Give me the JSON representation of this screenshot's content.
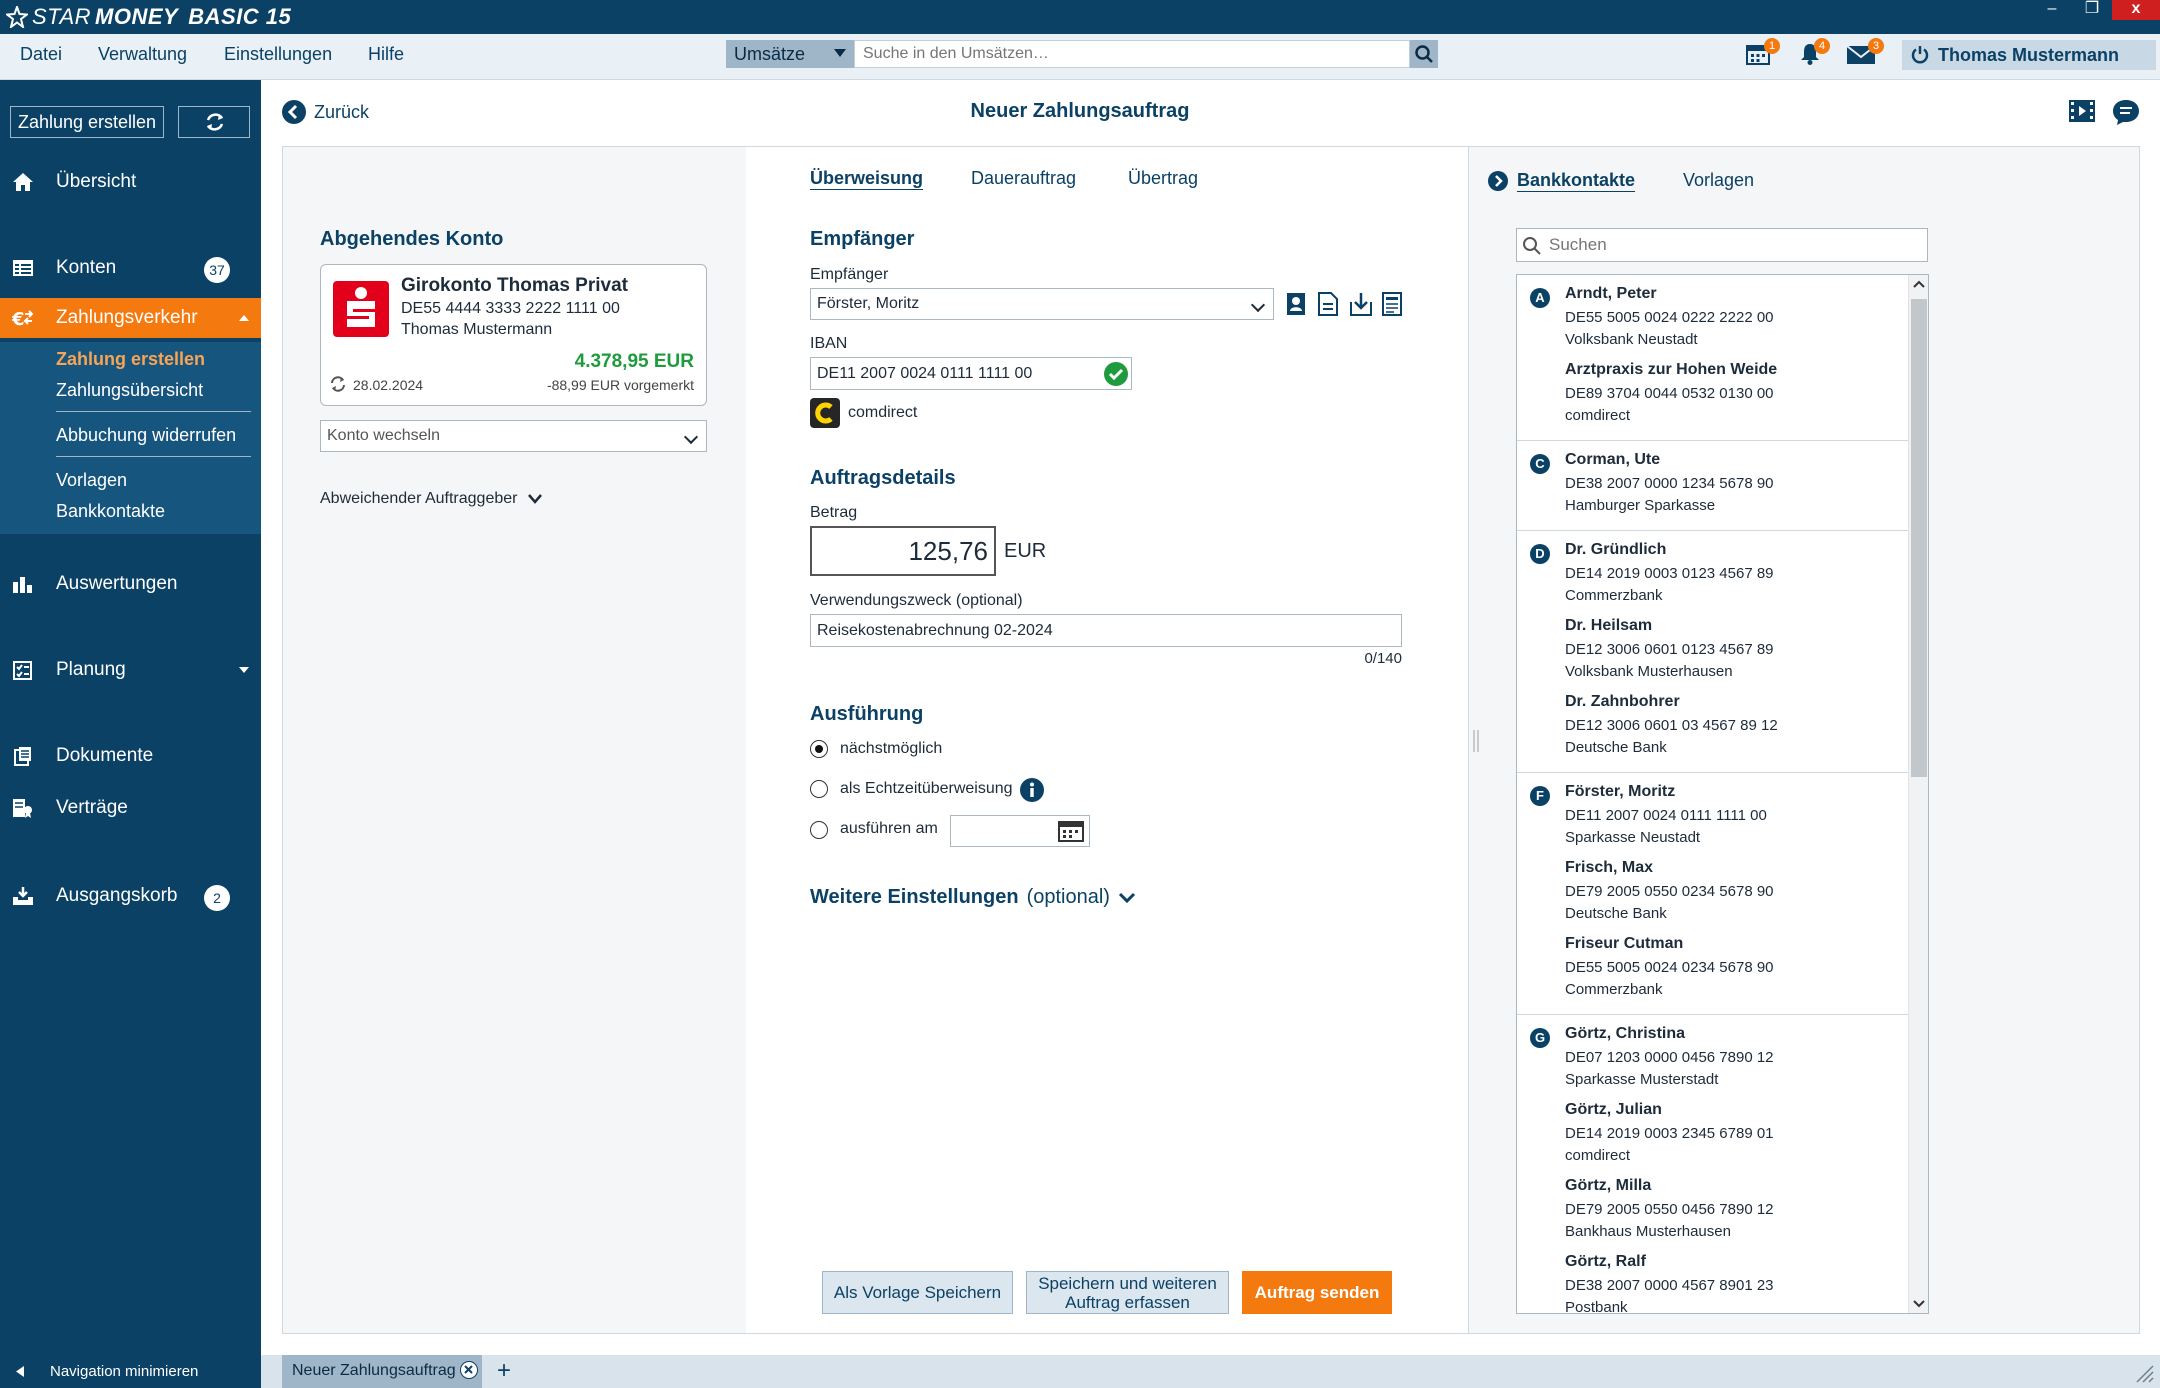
{
  "app": {
    "logo_prefix": "STAR",
    "logo_bold": "MONEY",
    "logo_suffix": "BASIC 15",
    "window_close": "x"
  },
  "menu": {
    "items": [
      "Datei",
      "Verwaltung",
      "Einstellungen",
      "Hilfe"
    ],
    "search_category": "Umsätze",
    "search_placeholder": "Suche in den Umsätzen…",
    "badges": {
      "calendar": "1",
      "bell": "4",
      "mail": "3"
    },
    "user": "Thomas Mustermann"
  },
  "sidebar": {
    "create_button": "Zahlung erstellen",
    "nav": {
      "uebersicht": "Übersicht",
      "konten": "Konten",
      "konten_badge": "37",
      "zahlungsverkehr": "Zahlungsverkehr",
      "auswertungen": "Auswertungen",
      "planung": "Planung",
      "dokumente": "Dokumente",
      "vertraege": "Verträge",
      "ausgangskorb": "Ausgangskorb",
      "ausgangskorb_badge": "2"
    },
    "sub": [
      "Zahlung erstellen",
      "Zahlungsübersicht",
      "Abbuchung widerrufen",
      "Vorlagen",
      "Bankkontakte"
    ],
    "minimize": "Navigation minimieren"
  },
  "header": {
    "back": "Zurück",
    "title": "Neuer Zahlungsauftrag"
  },
  "left": {
    "heading": "Abgehendes Konto",
    "account_name": "Girokonto Thomas Privat",
    "account_iban": "DE55 4444 3333 2222 1111 00",
    "account_owner": "Thomas Mustermann",
    "balance": "4.378,95 EUR",
    "date": "28.02.2024",
    "pending": "-88,99 EUR vorgemerkt",
    "switch_placeholder": "Konto wechseln",
    "other_payer": "Abweichender Auftraggeber",
    "colors": {
      "balance": "#1e9b3c",
      "sparkasse": "#e2001a"
    }
  },
  "center": {
    "tabs": [
      "Überweisung",
      "Dauerauftrag",
      "Übertrag"
    ],
    "recipient_heading": "Empfänger",
    "recipient_label": "Empfänger",
    "recipient_value": "Förster, Moritz",
    "iban_label": "IBAN",
    "iban_value": "DE11 2007 0024 0111 1111 00",
    "bank_name": "comdirect",
    "details_heading": "Auftragsdetails",
    "amount_label": "Betrag",
    "amount_value": "125,76",
    "currency": "EUR",
    "purpose_label": "Verwendungszweck (optional)",
    "purpose_value": "Reisekostenabrechnung 02-2024",
    "purpose_counter": "0/140",
    "execution_heading": "Ausführung",
    "exec_options": [
      "nächstmöglich",
      "als Echtzeitüberweisung",
      "ausführen am"
    ],
    "more_settings": "Weitere Einstellungen",
    "more_settings_optional": "(optional)",
    "btn_template": "Als Vorlage Speichern",
    "btn_save_more_1": "Speichern und weiteren",
    "btn_save_more_2": "Auftrag erfassen",
    "btn_send": "Auftrag senden"
  },
  "right": {
    "tabs": [
      "Bankkontakte",
      "Vorlagen"
    ],
    "search_placeholder": "Suchen",
    "groups": [
      {
        "letter": "A",
        "contacts": [
          {
            "name": "Arndt, Peter",
            "iban": "DE55 5005 0024 0222 2222 00",
            "bank": "Volksbank Neustadt"
          },
          {
            "name": "Arztpraxis zur Hohen Weide",
            "iban": "DE89 3704 0044 0532 0130 00",
            "bank": "comdirect"
          }
        ]
      },
      {
        "letter": "C",
        "contacts": [
          {
            "name": "Corman, Ute",
            "iban": "DE38 2007 0000 1234 5678 90",
            "bank": "Hamburger Sparkasse"
          }
        ]
      },
      {
        "letter": "D",
        "contacts": [
          {
            "name": "Dr. Gründlich",
            "iban": "DE14 2019 0003 0123 4567 89",
            "bank": "Commerzbank"
          },
          {
            "name": "Dr. Heilsam",
            "iban": "DE12 3006 0601 0123 4567 89",
            "bank": "Volksbank Musterhausen"
          },
          {
            "name": "Dr. Zahnbohrer",
            "iban": "DE12 3006 0601 03 4567 89 12",
            "bank": "Deutsche Bank"
          }
        ]
      },
      {
        "letter": "F",
        "contacts": [
          {
            "name": "Förster, Moritz",
            "iban": "DE11 2007 0024 0111 1111 00",
            "bank": "Sparkasse Neustadt"
          },
          {
            "name": "Frisch, Max",
            "iban": "DE79 2005 0550 0234 5678 90",
            "bank": "Deutsche Bank"
          },
          {
            "name": "Friseur Cutman",
            "iban": "DE55 5005 0024 0234 5678 90",
            "bank": "Commerzbank"
          }
        ]
      },
      {
        "letter": "G",
        "contacts": [
          {
            "name": "Görtz, Christina",
            "iban": "DE07 1203 0000 0456 7890 12",
            "bank": "Sparkasse Musterstadt"
          },
          {
            "name": "Görtz, Julian",
            "iban": "DE14 2019 0003 2345 6789 01",
            "bank": "comdirect"
          },
          {
            "name": "Görtz, Milla",
            "iban": "DE79 2005 0550 0456 7890 12",
            "bank": "Bankhaus Musterhausen"
          },
          {
            "name": "Görtz, Ralf",
            "iban": "DE38 2007 0000 4567 8901 23",
            "bank": "Postbank"
          }
        ]
      }
    ]
  },
  "bottom": {
    "tab": "Neuer Zahlungsauftrag"
  },
  "colors": {
    "primary": "#0b4165",
    "accent": "#f47a10"
  }
}
